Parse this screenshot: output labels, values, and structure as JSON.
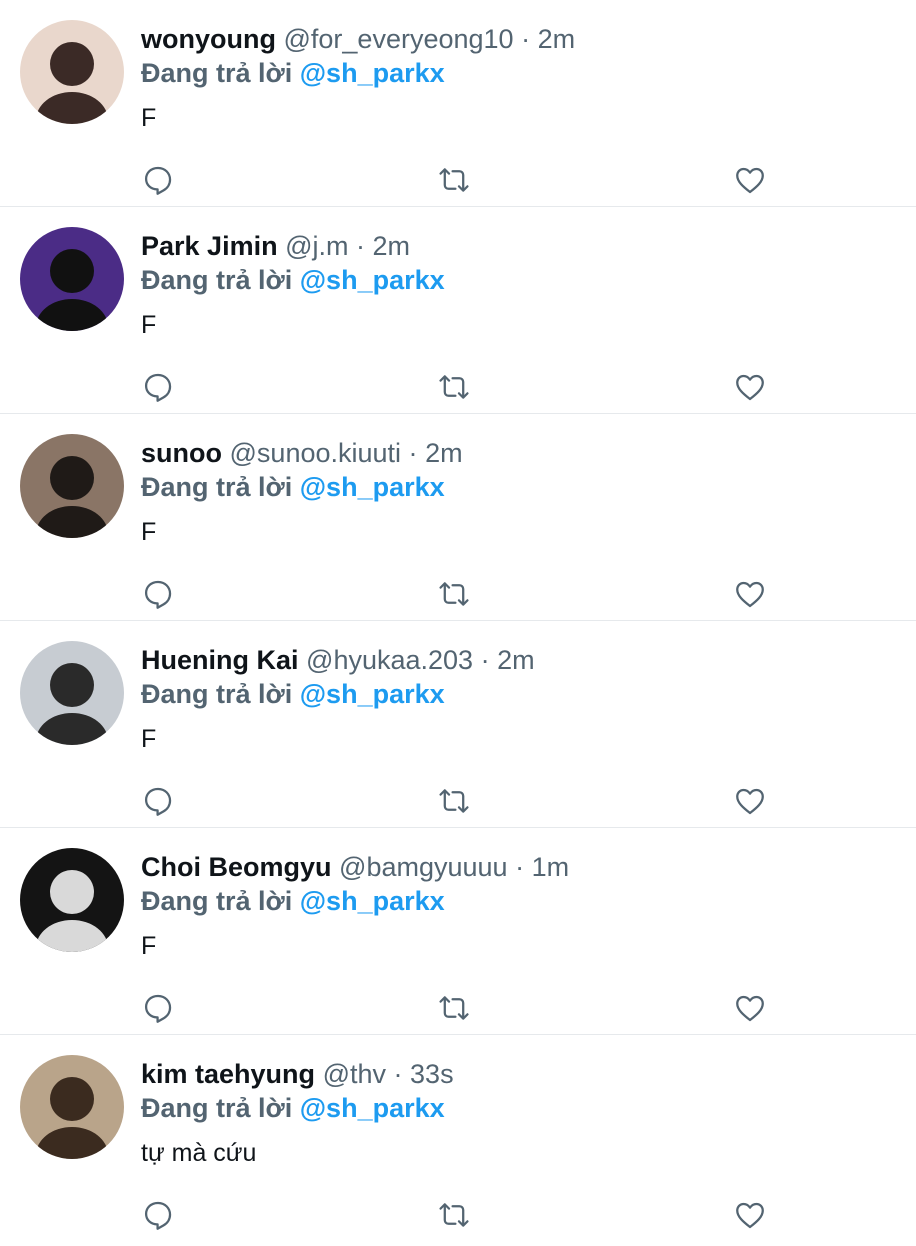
{
  "reply_prefix": "Đang trả lời",
  "icons": {
    "reply": "reply-icon",
    "retweet": "retweet-icon",
    "like": "heart-icon"
  },
  "colors": {
    "mention": "#1d9bf0",
    "secondary": "#536471",
    "text": "#0f1419",
    "divider": "#e6e9ec"
  },
  "tweets": [
    {
      "name": "wonyoung",
      "handle": "@for_everyeong10",
      "time": "2m",
      "replying_to": "@sh_parkx",
      "text": "F",
      "avatar": {
        "bg": "#e9d7cc",
        "fg": "#3b2a26"
      }
    },
    {
      "name": "Park Jimin",
      "handle": "@j.m",
      "time": "2m",
      "replying_to": "@sh_parkx",
      "text": "F",
      "avatar": {
        "bg": "#4b2c86",
        "fg": "#111111"
      }
    },
    {
      "name": "sunoo",
      "handle": "@sunoo.kiuuti",
      "time": "2m",
      "replying_to": "@sh_parkx",
      "text": "F",
      "avatar": {
        "bg": "#8a7566",
        "fg": "#1f1a17"
      }
    },
    {
      "name": "Huening Kai",
      "handle": "@hyukaa.203",
      "time": "2m",
      "replying_to": "@sh_parkx",
      "text": "F",
      "avatar": {
        "bg": "#c7ccd2",
        "fg": "#2a2a2a"
      }
    },
    {
      "name": "Choi Beomgyu",
      "handle": "@bamgyuuuu",
      "time": "1m",
      "replying_to": "@sh_parkx",
      "text": "F",
      "avatar": {
        "bg": "#141414",
        "fg": "#d9d9d9"
      }
    },
    {
      "name": "kim taehyung",
      "handle": "@thv",
      "time": "33s",
      "replying_to": "@sh_parkx",
      "text": "tự mà cứu",
      "avatar": {
        "bg": "#b9a48a",
        "fg": "#3b2b1f"
      }
    }
  ]
}
